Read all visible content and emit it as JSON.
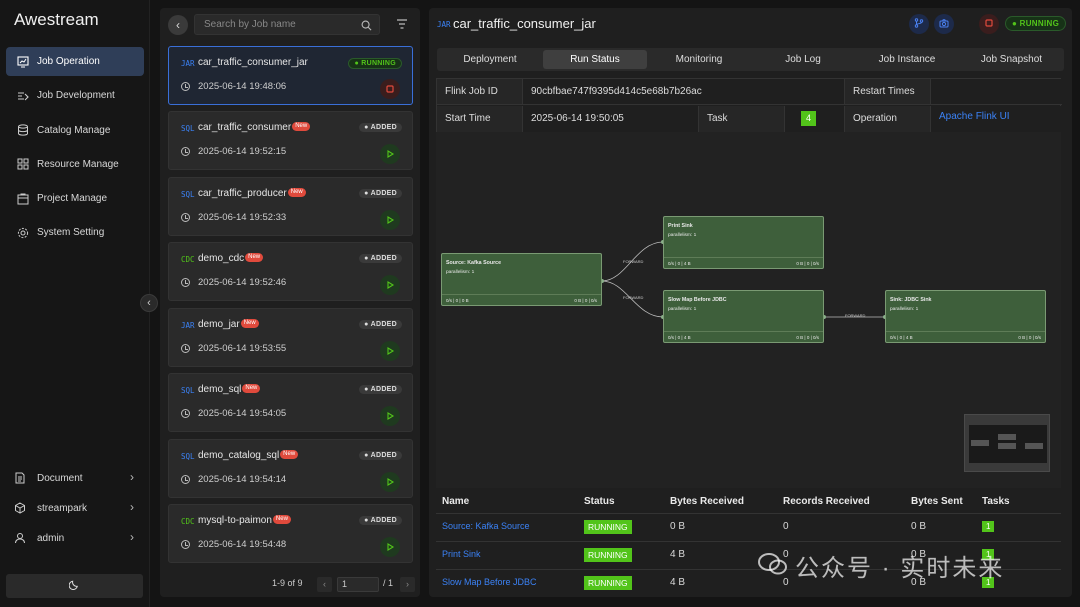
{
  "app": {
    "title": "Awestream"
  },
  "sidebar": {
    "items": [
      {
        "label": "Job Operation",
        "icon": "job-operation-icon",
        "active": true
      },
      {
        "label": "Job Development",
        "icon": "job-development-icon"
      },
      {
        "label": "Catalog Manage",
        "icon": "catalog-icon"
      },
      {
        "label": "Resource Manage",
        "icon": "resource-icon"
      },
      {
        "label": "Project Manage",
        "icon": "project-icon"
      },
      {
        "label": "System Setting",
        "icon": "setting-icon"
      }
    ],
    "bottom": [
      {
        "label": "Document",
        "icon": "document-icon"
      },
      {
        "label": "streampark",
        "icon": "cube-icon"
      },
      {
        "label": "admin",
        "icon": "user-icon"
      }
    ]
  },
  "joblist": {
    "search_placeholder": "Search by Job name",
    "items": [
      {
        "type": "JAR",
        "name": "car_traffic_consumer_jar",
        "new": false,
        "status": "RUNNING",
        "time": "2025-06-14 19:48:06"
      },
      {
        "type": "SQL",
        "name": "car_traffic_consumer",
        "new": true,
        "status": "ADDED",
        "time": "2025-06-14 19:52:15"
      },
      {
        "type": "SQL",
        "name": "car_traffic_producer",
        "new": true,
        "status": "ADDED",
        "time": "2025-06-14 19:52:33"
      },
      {
        "type": "CDC",
        "name": "demo_cdc",
        "new": true,
        "status": "ADDED",
        "time": "2025-06-14 19:52:46"
      },
      {
        "type": "JAR",
        "name": "demo_jar",
        "new": true,
        "status": "ADDED",
        "time": "2025-06-14 19:53:55"
      },
      {
        "type": "SQL",
        "name": "demo_sql",
        "new": true,
        "status": "ADDED",
        "time": "2025-06-14 19:54:05"
      },
      {
        "type": "SQL",
        "name": "demo_catalog_sql",
        "new": true,
        "status": "ADDED",
        "time": "2025-06-14 19:54:14"
      },
      {
        "type": "CDC",
        "name": "mysql-to-paimon",
        "new": true,
        "status": "ADDED",
        "time": "2025-06-14 19:54:48"
      }
    ],
    "new_label": "New",
    "pagination": {
      "range": "1-9 of 9",
      "page": "1",
      "total": "/ 1"
    }
  },
  "detail": {
    "type": "JAR",
    "title": "car_traffic_consumer_jar",
    "status": "RUNNING",
    "tabs": [
      "Deployment",
      "Run Status",
      "Monitoring",
      "Job Log",
      "Job Instance",
      "Job Snapshot"
    ],
    "active_tab": "Run Status",
    "info": {
      "flink_job_id_label": "Flink Job ID",
      "flink_job_id": "90cbfbae747f9395d414c5e68b7b26ac",
      "restart_label": "Restart Times",
      "restart_value": "",
      "start_label": "Start Time",
      "start_value": "2025-06-14 19:50:05",
      "task_label": "Task",
      "task_value": "4",
      "operation_label": "Operation",
      "operation_value": "Apache Flink UI"
    },
    "graph": {
      "nodes": [
        {
          "title": "Source: Kafka Source",
          "parallelism": "parallelism: 1",
          "metrics_left": "0/s   |   0   |   0 B",
          "metrics_right": "0 B   |   0   |   0/s"
        },
        {
          "title": "Print Sink",
          "parallelism": "parallelism: 1",
          "metrics_left": "0/s   |   0   |   4 B",
          "metrics_right": "0 B   |   0   |   0/s"
        },
        {
          "title": "Slow Map Before JDBC",
          "parallelism": "parallelism: 1",
          "metrics_left": "0/s   |   0   |   4 B",
          "metrics_right": "0 B   |   0   |   0/s"
        },
        {
          "title": "Sink: JDBC Sink",
          "parallelism": "parallelism: 1",
          "metrics_left": "0/s   |   0   |   4 B",
          "metrics_right": "0 B   |   0   |   0/s"
        }
      ],
      "edge_label": "FORWARD"
    },
    "table": {
      "headers": [
        "Name",
        "Status",
        "Bytes Received",
        "Records Received",
        "Bytes Sent",
        "Tasks"
      ],
      "rows": [
        {
          "name": "Source: Kafka Source",
          "status": "RUNNING",
          "bytes_received": "0 B",
          "records_received": "0",
          "bytes_sent": "0 B",
          "tasks": "1"
        },
        {
          "name": "Print Sink",
          "status": "RUNNING",
          "bytes_received": "4 B",
          "records_received": "0",
          "bytes_sent": "0 B",
          "tasks": "1"
        },
        {
          "name": "Slow Map Before JDBC",
          "status": "RUNNING",
          "bytes_received": "4 B",
          "records_received": "0",
          "bytes_sent": "0 B",
          "tasks": "1"
        }
      ]
    }
  },
  "watermark": {
    "text": "公众号 · 实时未来"
  }
}
